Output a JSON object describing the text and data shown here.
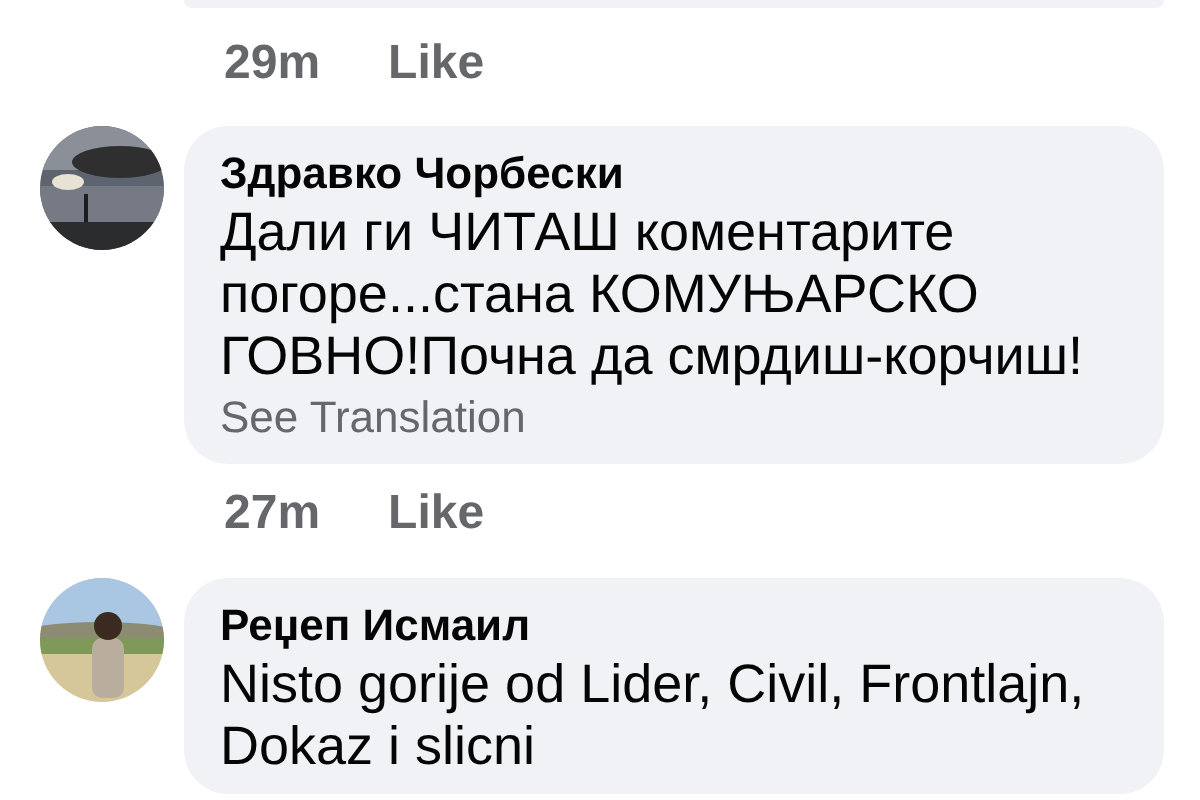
{
  "previous_comment": {
    "time": "29m",
    "like": "Like"
  },
  "comments": [
    {
      "author": "Здравко Чорбески",
      "text": "Дали ги ЧИТАШ коментарите погоре...стана КОМУЊАРСКО ГОВНО!Почна да смрдиш-корчиш!",
      "translation_link": "See Translation",
      "time": "27m",
      "like": "Like"
    },
    {
      "author": "Реџеп Исмаил",
      "text": "Nisto gorije od Lider, Civil, Frontlajn, Dokaz i slicni"
    }
  ]
}
